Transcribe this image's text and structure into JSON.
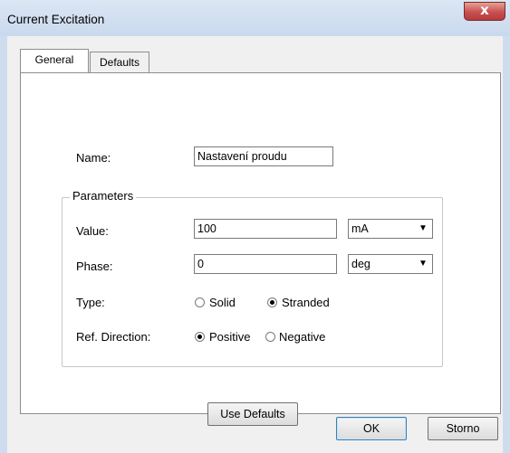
{
  "window": {
    "title": "Current Excitation",
    "close_glyph": "x"
  },
  "tabs": [
    {
      "label": "General",
      "selected": true
    },
    {
      "label": "Defaults",
      "selected": false
    }
  ],
  "form": {
    "name_label": "Name:",
    "name_value": "Nastavení proudu",
    "parameters_title": "Parameters",
    "value_label": "Value:",
    "value_input": "100",
    "value_unit": "mA",
    "phase_label": "Phase:",
    "phase_input": "0",
    "phase_unit": "deg",
    "type_label": "Type:",
    "type_options": [
      {
        "label": "Solid",
        "checked": false
      },
      {
        "label": "Stranded",
        "checked": true
      }
    ],
    "ref_direction_label": "Ref. Direction:",
    "ref_direction_options": [
      {
        "label": "Positive",
        "checked": true
      },
      {
        "label": "Negative",
        "checked": false
      }
    ],
    "use_defaults_label": "Use Defaults"
  },
  "footer": {
    "ok_label": "OK",
    "cancel_label": "Storno"
  },
  "icons": {
    "close": "close-icon",
    "dropdown": "chevron-down-icon"
  },
  "colors": {
    "close_button": "#c75050",
    "titlebar": "#dbe6f4"
  }
}
